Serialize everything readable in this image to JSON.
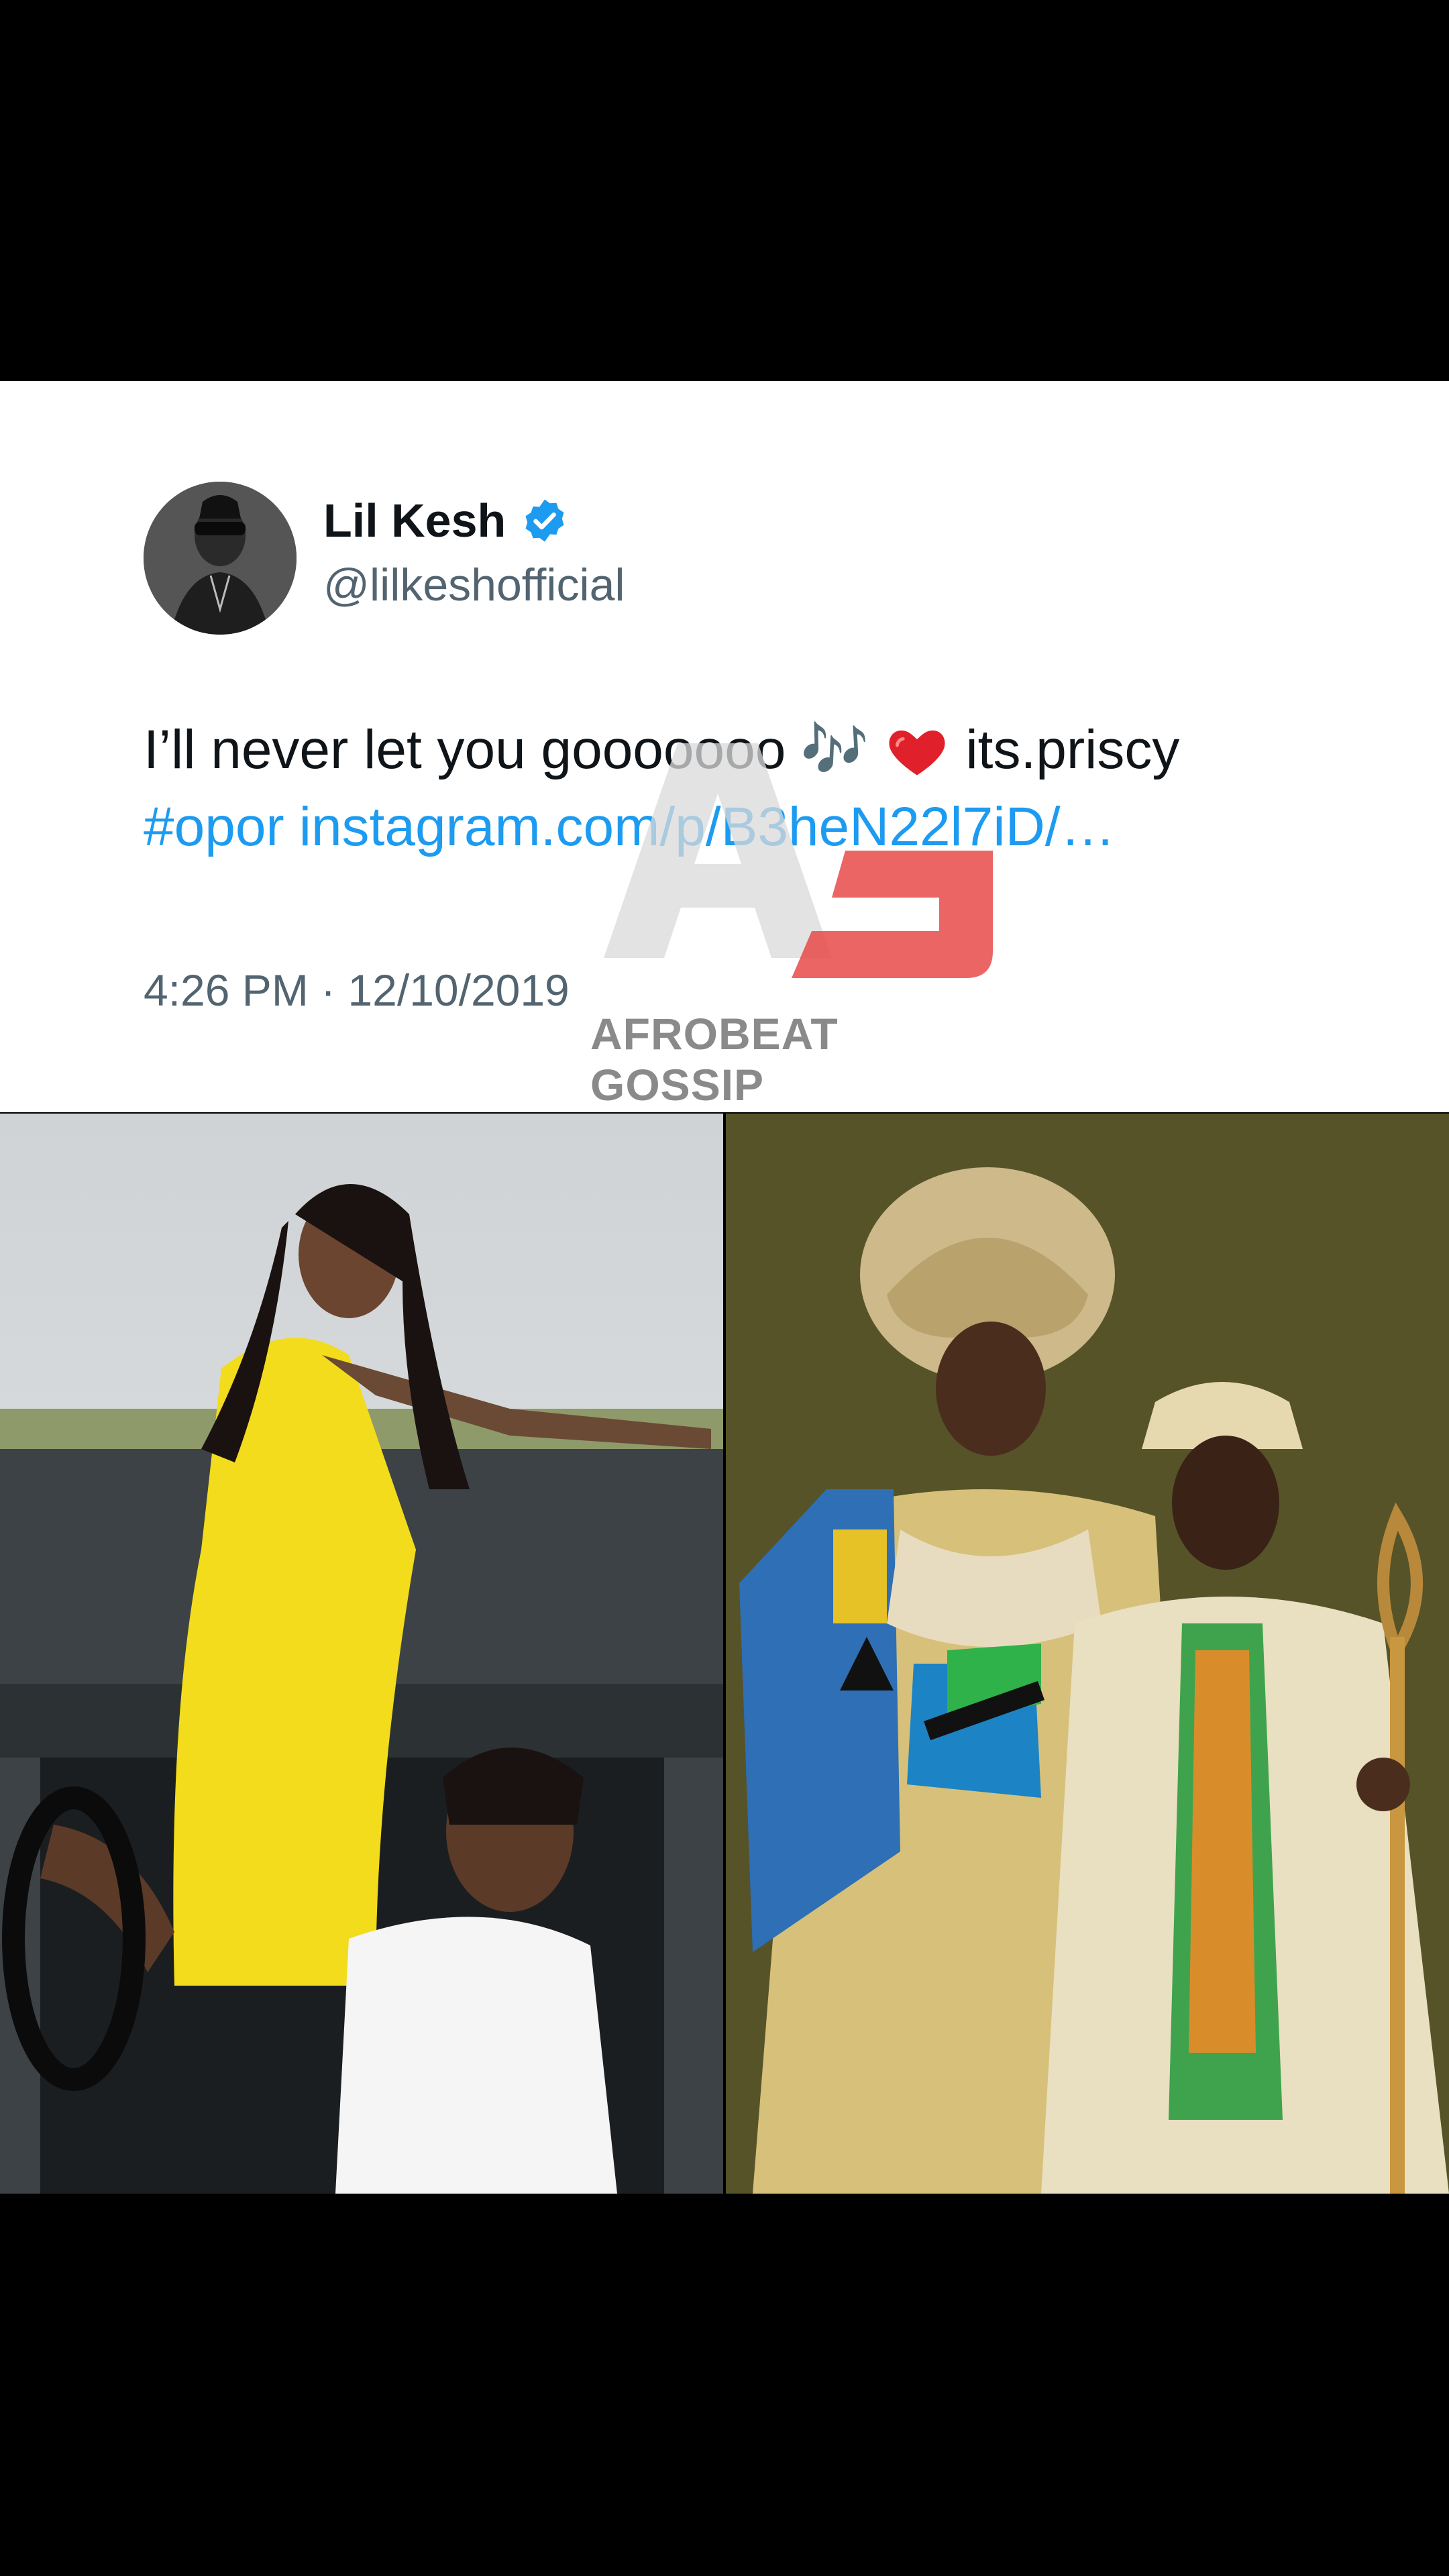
{
  "tweet": {
    "author_name": "Lil Kesh",
    "handle": "@lilkeshofficial",
    "text_part1": "I’ll never let you gooooooo",
    "music_emoji": "🎶",
    "heart_icon": "red-heart",
    "mention": "its.priscy",
    "hashtag": "#opor",
    "link": "instagram.com/p/B3heN22l7iD/…",
    "timestamp": "4:26 PM · 12/10/2019",
    "verified_color": "#1d9bf0",
    "link_color": "#1d9bf0"
  },
  "watermark": {
    "text": "AFROBEAT GOSSIP"
  },
  "colors": {
    "background": "#000000",
    "card": "#ffffff"
  }
}
